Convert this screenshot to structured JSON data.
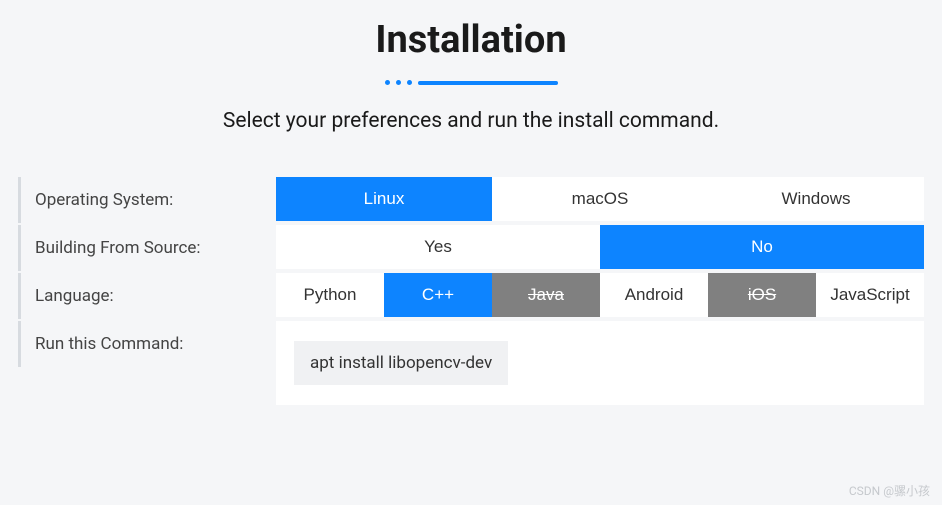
{
  "title": "Installation",
  "subtitle": "Select your preferences and run the install command.",
  "labels": {
    "os": "Operating System:",
    "build": "Building From Source:",
    "lang": "Language:",
    "cmd": "Run this Command:"
  },
  "rows": {
    "os": [
      {
        "label": "Linux",
        "state": "selected"
      },
      {
        "label": "macOS",
        "state": "normal"
      },
      {
        "label": "Windows",
        "state": "normal"
      }
    ],
    "build": [
      {
        "label": "Yes",
        "state": "normal"
      },
      {
        "label": "No",
        "state": "selected"
      }
    ],
    "lang": [
      {
        "label": "Python",
        "state": "normal"
      },
      {
        "label": "C++",
        "state": "selected"
      },
      {
        "label": "Java",
        "state": "disabled"
      },
      {
        "label": "Android",
        "state": "normal"
      },
      {
        "label": "iOS",
        "state": "disabled"
      },
      {
        "label": "JavaScript",
        "state": "normal"
      }
    ]
  },
  "command": "apt install libopencv-dev",
  "watermark": "CSDN @骡小孩",
  "colors": {
    "accent": "#0d84ff",
    "disabled": "#808080",
    "bg": "#f5f6f8"
  }
}
